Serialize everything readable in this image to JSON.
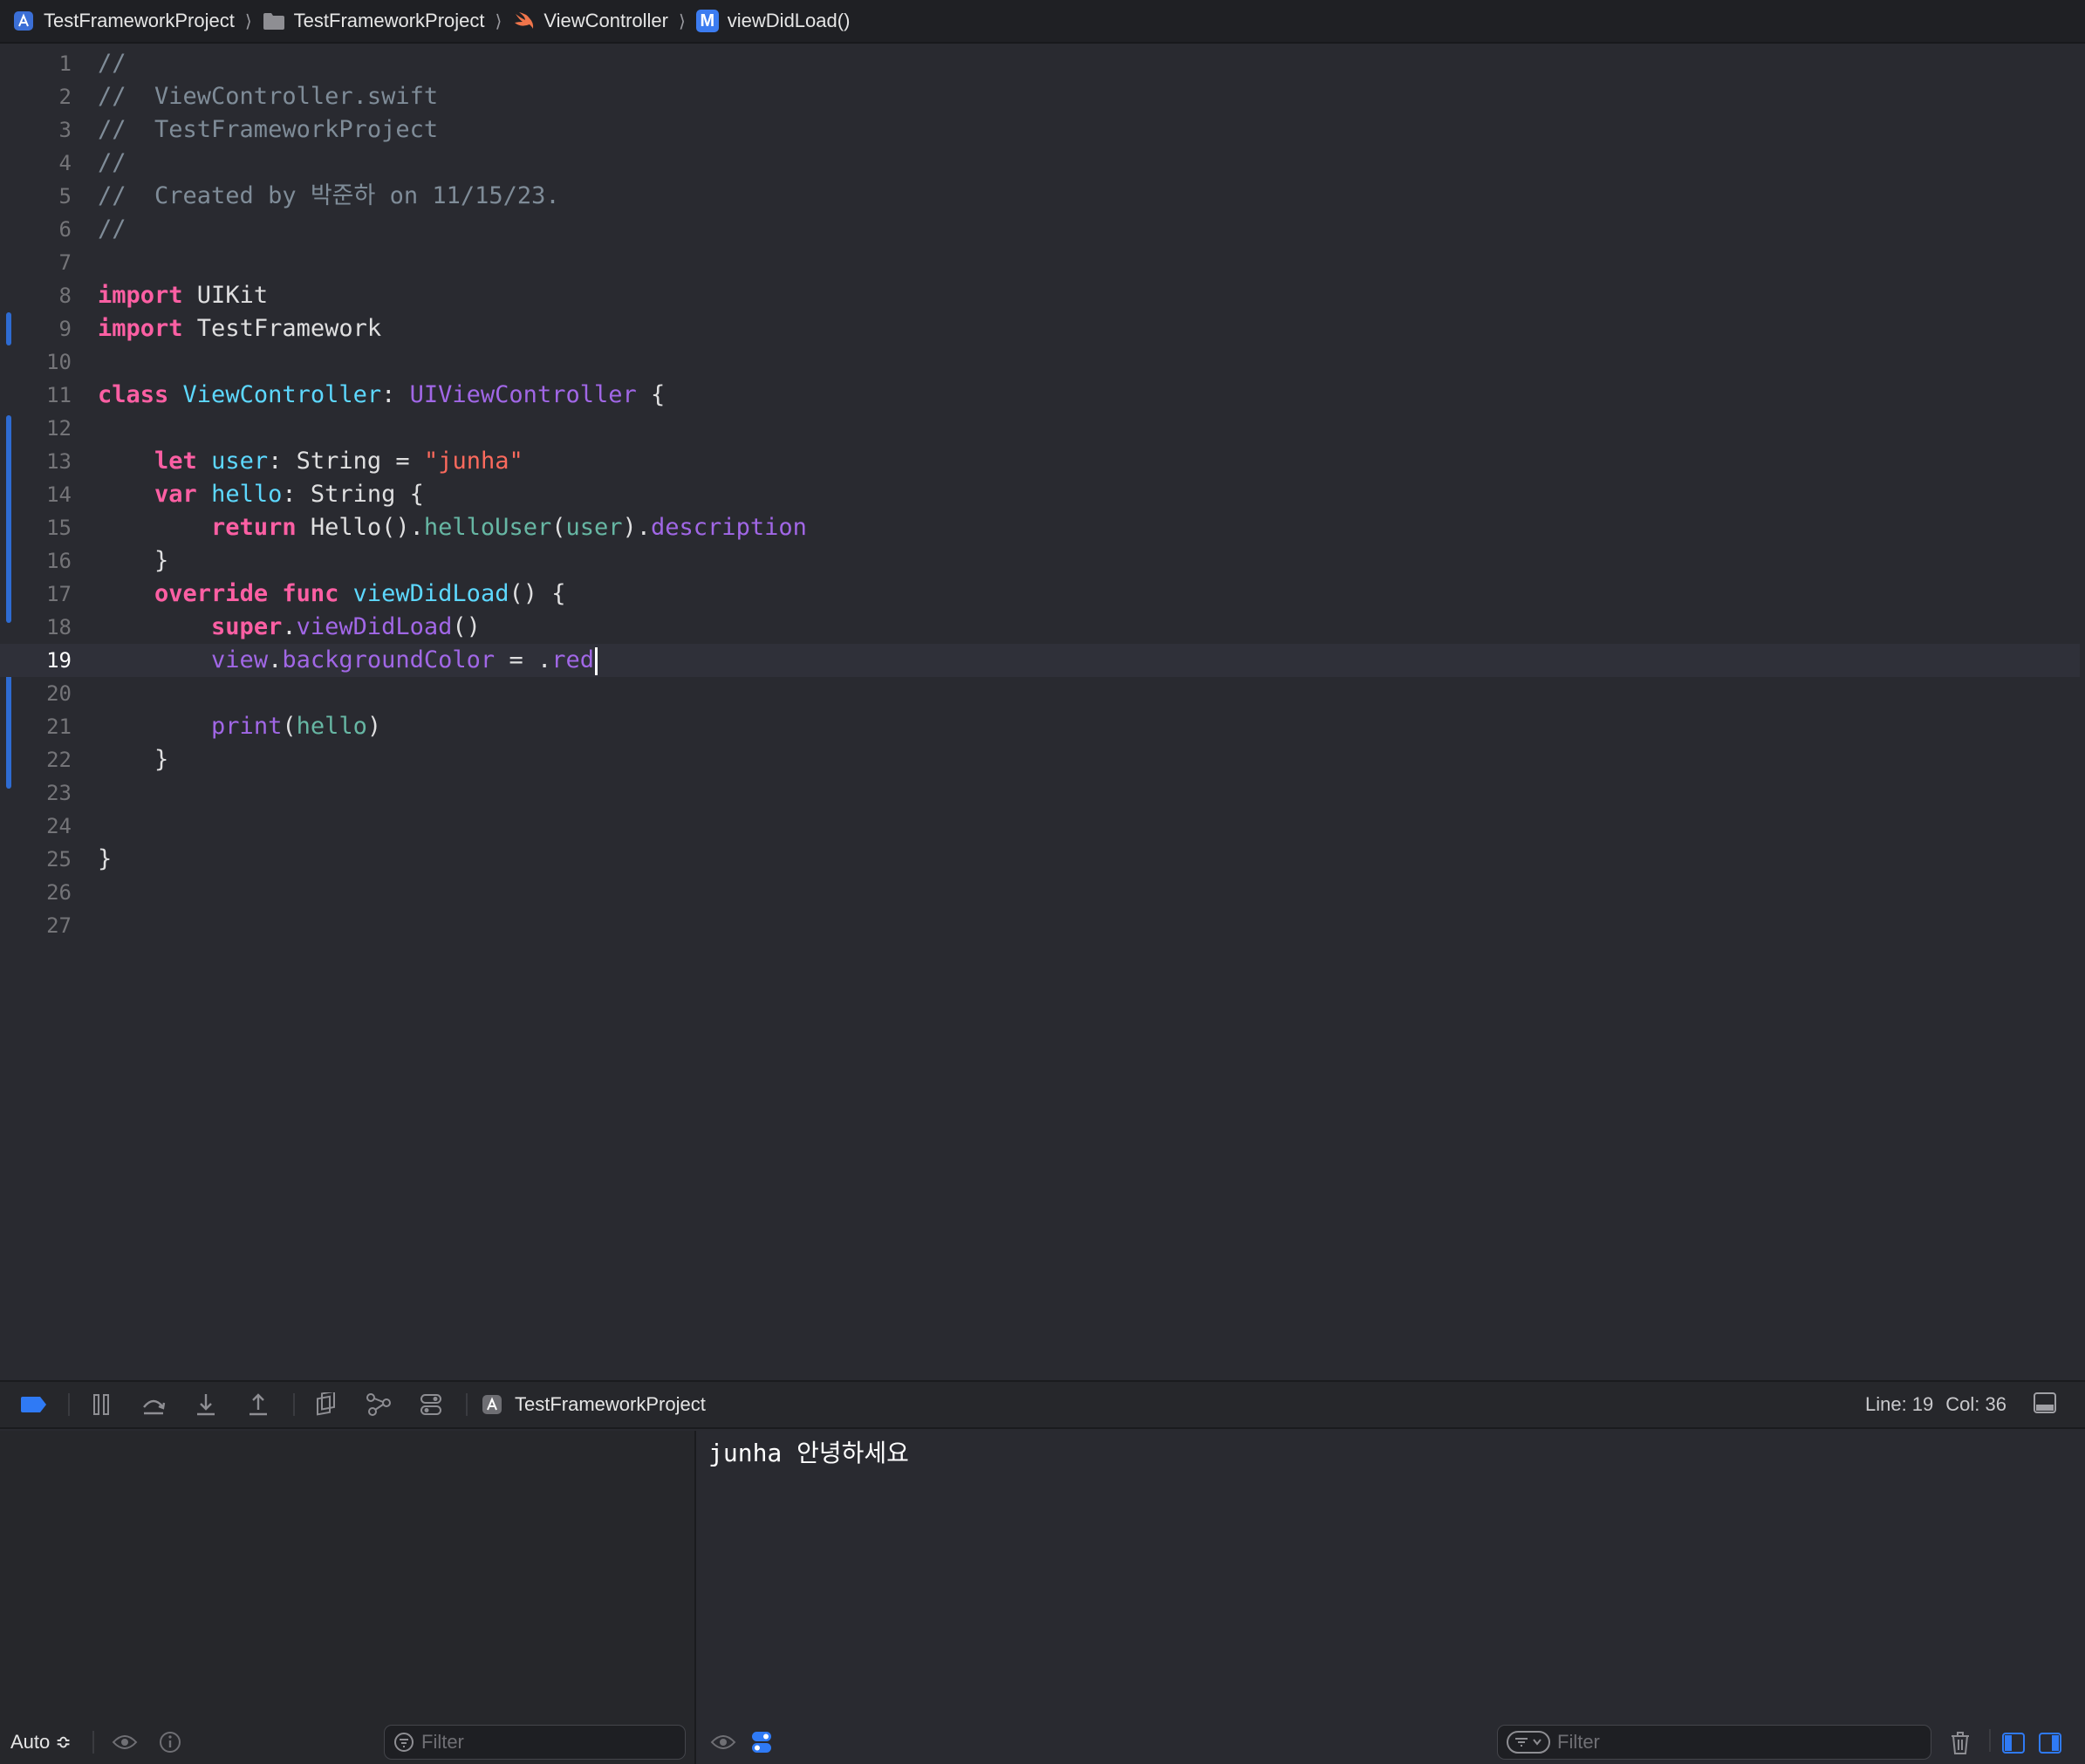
{
  "jumpbar": {
    "crumbs": [
      {
        "label": "TestFrameworkProject",
        "icon": "app-project-icon"
      },
      {
        "label": "TestFrameworkProject",
        "icon": "folder-icon"
      },
      {
        "label": "ViewController",
        "icon": "swift-file-icon"
      },
      {
        "label": "viewDidLoad()",
        "icon": "method-icon"
      }
    ],
    "method_badge": "M"
  },
  "editor": {
    "current_line": 19,
    "line_numbers": [
      "1",
      "2",
      "3",
      "4",
      "5",
      "6",
      "7",
      "8",
      "9",
      "10",
      "11",
      "12",
      "13",
      "14",
      "15",
      "16",
      "17",
      "18",
      "19",
      "20",
      "21",
      "22",
      "23",
      "24",
      "25",
      "26",
      "27"
    ],
    "code": {
      "l1": "//",
      "l2": "//  ViewController.swift",
      "l3": "//  TestFrameworkProject",
      "l4": "//",
      "l5": "//  Created by 박준하 on 11/15/23.",
      "l6": "//",
      "l8_kw": "import",
      "l8_rest": " UIKit",
      "l9_kw": "import",
      "l9_rest": " TestFramework",
      "l11_kw": "class",
      "l11_name": "ViewController",
      "l11_colon": ": ",
      "l11_super": "UIViewController",
      "l11_brace": " {",
      "l13_kw": "let",
      "l13_var": "user",
      "l13_colon": ": ",
      "l13_type": "String",
      "l13_eq": " = ",
      "l13_str": "\"junha\"",
      "l14_kw": "var",
      "l14_var": "hello",
      "l14_colon": ": ",
      "l14_type": "String",
      "l14_brace": " {",
      "l15_kw": "return",
      "l15_a": " Hello().",
      "l15_fn": "helloUser",
      "l15_b": "(",
      "l15_arg": "user",
      "l15_c": ").",
      "l15_prop": "description",
      "l16": "}",
      "l17_kw1": "override",
      "l17_kw2": "func",
      "l17_fn": "viewDidLoad",
      "l17_rest": "() {",
      "l18_kw": "super",
      "l18_dot": ".",
      "l18_fn": "viewDidLoad",
      "l18_rest": "()",
      "l19_a": "view",
      "l19_dot": ".",
      "l19_prop": "backgroundColor",
      "l19_eq": " = .",
      "l19_val": "red",
      "l21_fn": "print",
      "l21_open": "(",
      "l21_arg": "hello",
      "l21_close": ")",
      "l22": "}",
      "l25": "}"
    }
  },
  "debugbar": {
    "scheme": "TestFrameworkProject",
    "line_label": "Line: 19",
    "col_label": "Col: 36"
  },
  "variables": {
    "mode": "Auto ≎",
    "filter_placeholder": "Filter"
  },
  "console": {
    "output": "junha 안녕하세요",
    "filter_placeholder": "Filter"
  },
  "colors": {
    "background": "#292a30",
    "keyword": "#fc5fa3",
    "type": "#5dd8ff",
    "string": "#fc6a5d",
    "function": "#a167e6",
    "comment": "#7f8c98",
    "accent": "#2e6bd1"
  }
}
